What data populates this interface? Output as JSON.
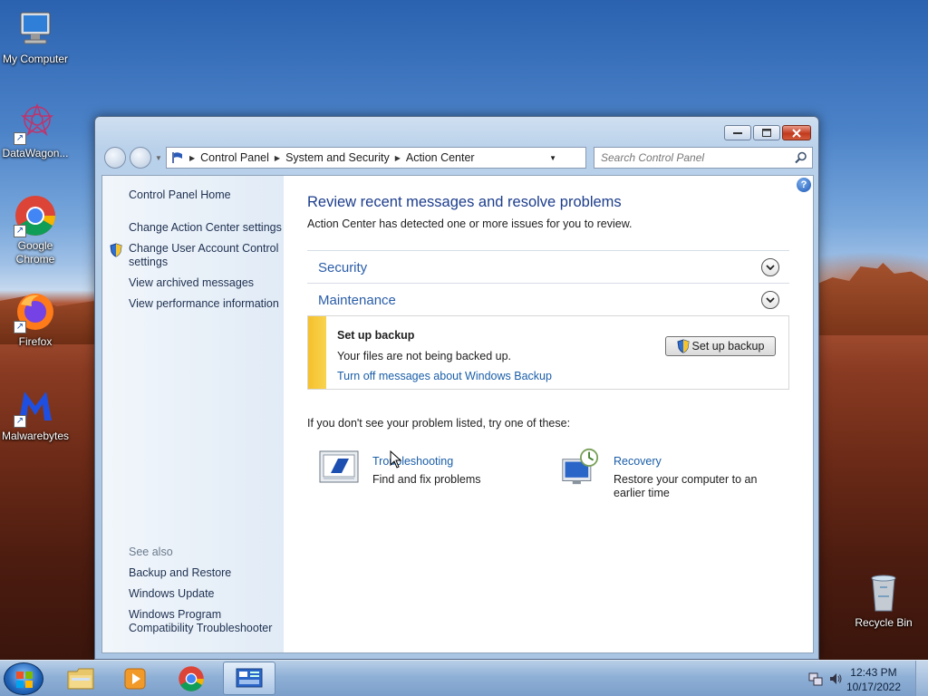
{
  "desktop": {
    "icons": [
      {
        "label": "My Computer"
      },
      {
        "label": "DataWagon..."
      },
      {
        "label": "Google Chrome"
      },
      {
        "label": "Firefox"
      },
      {
        "label": "Malwarebytes"
      },
      {
        "label": "Recycle Bin"
      }
    ]
  },
  "window": {
    "breadcrumb": [
      "Control Panel",
      "System and Security",
      "Action Center"
    ],
    "search_placeholder": "Search Control Panel",
    "sidebar": {
      "links": [
        "Control Panel Home",
        "Change Action Center settings",
        "Change User Account Control settings",
        "View archived messages",
        "View performance information"
      ],
      "see_also_heading": "See also",
      "see_also_links": [
        "Backup and Restore",
        "Windows Update",
        "Windows Program Compatibility Troubleshooter"
      ]
    },
    "main": {
      "title": "Review recent messages and resolve problems",
      "subtitle": "Action Center has detected one or more issues for you to review.",
      "sections": [
        "Security",
        "Maintenance"
      ],
      "message": {
        "title": "Set up backup",
        "text": "Your files are not being backed up.",
        "link": "Turn off messages about Windows Backup",
        "button": "Set up backup",
        "accent_color": "#f6c12c"
      },
      "hint": "If you don't see your problem listed, try one of these:",
      "tools": [
        {
          "link": "Troubleshooting",
          "desc": "Find and fix problems"
        },
        {
          "link": "Recovery",
          "desc": "Restore your computer to an earlier time"
        }
      ]
    }
  },
  "taskbar": {
    "time": "12:43 PM",
    "date": "10/17/2022"
  }
}
